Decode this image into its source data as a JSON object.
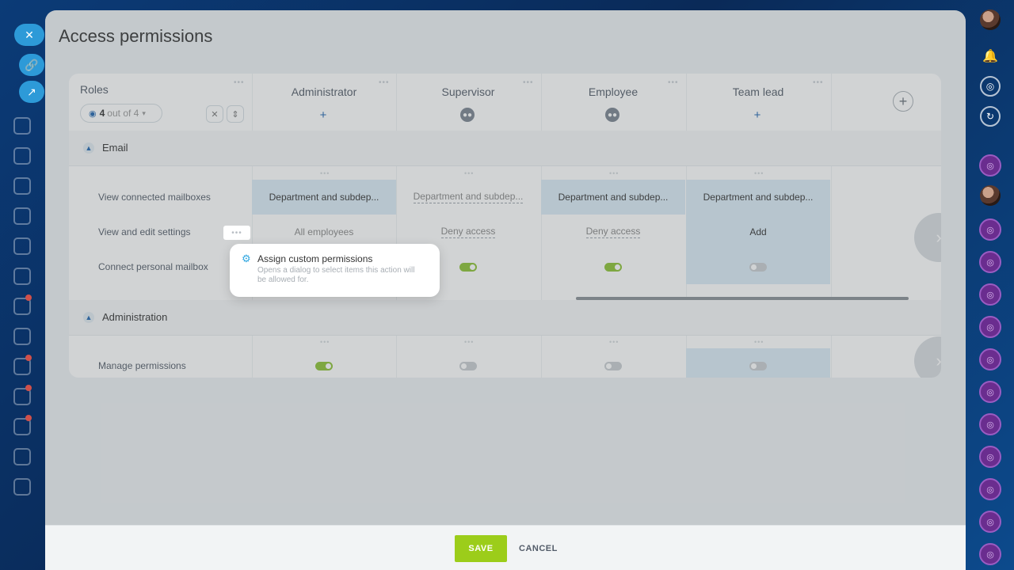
{
  "panel": {
    "title": "Access permissions"
  },
  "roles_column": {
    "label": "Roles",
    "filter_count": "4",
    "filter_suffix": "out of 4"
  },
  "roles": [
    {
      "name": "Administrator",
      "button": "add"
    },
    {
      "name": "Supervisor",
      "button": "group"
    },
    {
      "name": "Employee",
      "button": "group"
    },
    {
      "name": "Team lead",
      "button": "add"
    }
  ],
  "sections": [
    {
      "title": "Email",
      "rows": [
        {
          "label": "View connected mailboxes",
          "values": [
            "Department and subdep...",
            "Department and subdep...",
            "Department and subdep...",
            "Department and subdep..."
          ]
        },
        {
          "label": "View and edit settings",
          "values": [
            "All employees",
            "Deny access",
            "Deny access",
            "Add"
          ]
        },
        {
          "label": "Connect personal mailbox",
          "values": [
            "on",
            "on",
            "on",
            "off"
          ]
        }
      ]
    },
    {
      "title": "Administration",
      "rows": [
        {
          "label": "Manage permissions",
          "values": [
            "on",
            "off",
            "off",
            "off"
          ]
        }
      ]
    }
  ],
  "popup": {
    "title": "Assign custom permissions",
    "description": "Opens a dialog to select items this action will be allowed for."
  },
  "footer": {
    "save_label": "SAVE",
    "cancel_label": "CANCEL"
  },
  "colors": {
    "accent": "#9ccd1a",
    "link": "#2066b0",
    "highlight": "#dcecf7",
    "toggle_on": "#8cc234"
  }
}
